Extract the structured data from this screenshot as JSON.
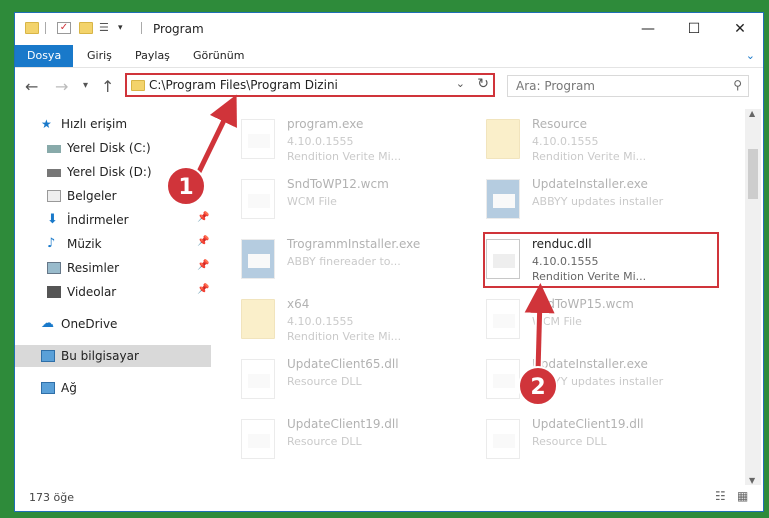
{
  "window": {
    "title": "Program"
  },
  "ribbon": {
    "tabs": [
      "Dosya",
      "Giriş",
      "Paylaş",
      "Görünüm"
    ]
  },
  "address": {
    "path": "C:\\Program Files\\Program Dizini"
  },
  "search": {
    "placeholder": "Ara: Program"
  },
  "sidebar": {
    "items": [
      {
        "label": "Hızlı erişim"
      },
      {
        "label": "Yerel Disk (C:)"
      },
      {
        "label": "Yerel Disk (D:)"
      },
      {
        "label": "Belgeler"
      },
      {
        "label": "İndirmeler"
      },
      {
        "label": "Müzik"
      },
      {
        "label": "Resimler"
      },
      {
        "label": "Videolar"
      },
      {
        "label": "OneDrive"
      },
      {
        "label": "Bu bilgisayar"
      },
      {
        "label": "Ağ"
      }
    ]
  },
  "files": [
    {
      "name": "program.exe",
      "l2": "4.10.0.1555",
      "l3": "Rendition Verite Mi..."
    },
    {
      "name": "Resource",
      "l2": "4.10.0.1555",
      "l3": "Rendition Verite Mi..."
    },
    {
      "name": "SndToWP12.wcm",
      "l2": "WCM File",
      "l3": ""
    },
    {
      "name": "UpdateInstaller.exe",
      "l2": "ABBYY updates installer",
      "l3": ""
    },
    {
      "name": "TrogrammInstaller.exe",
      "l2": "ABBY finereader to...",
      "l3": ""
    },
    {
      "name": "renduc.dll",
      "l2": "4.10.0.1555",
      "l3": "Rendition Verite Mi..."
    },
    {
      "name": "x64",
      "l2": "4.10.0.1555",
      "l3": "Rendition Verite Mi..."
    },
    {
      "name": "SndToWP15.wcm",
      "l2": "WCM File",
      "l3": ""
    },
    {
      "name": "UpdateClient65.dll",
      "l2": "Resource DLL",
      "l3": ""
    },
    {
      "name": "UpdateInstaller.exe",
      "l2": "ABBYY updates installer",
      "l3": ""
    },
    {
      "name": "UpdateClient19.dll",
      "l2": "Resource DLL",
      "l3": ""
    },
    {
      "name": "UpdateClient19.dll",
      "l2": "Resource DLL",
      "l3": ""
    }
  ],
  "status": {
    "count": "173 öğe"
  },
  "annotations": {
    "step1": "1",
    "step2": "2"
  }
}
